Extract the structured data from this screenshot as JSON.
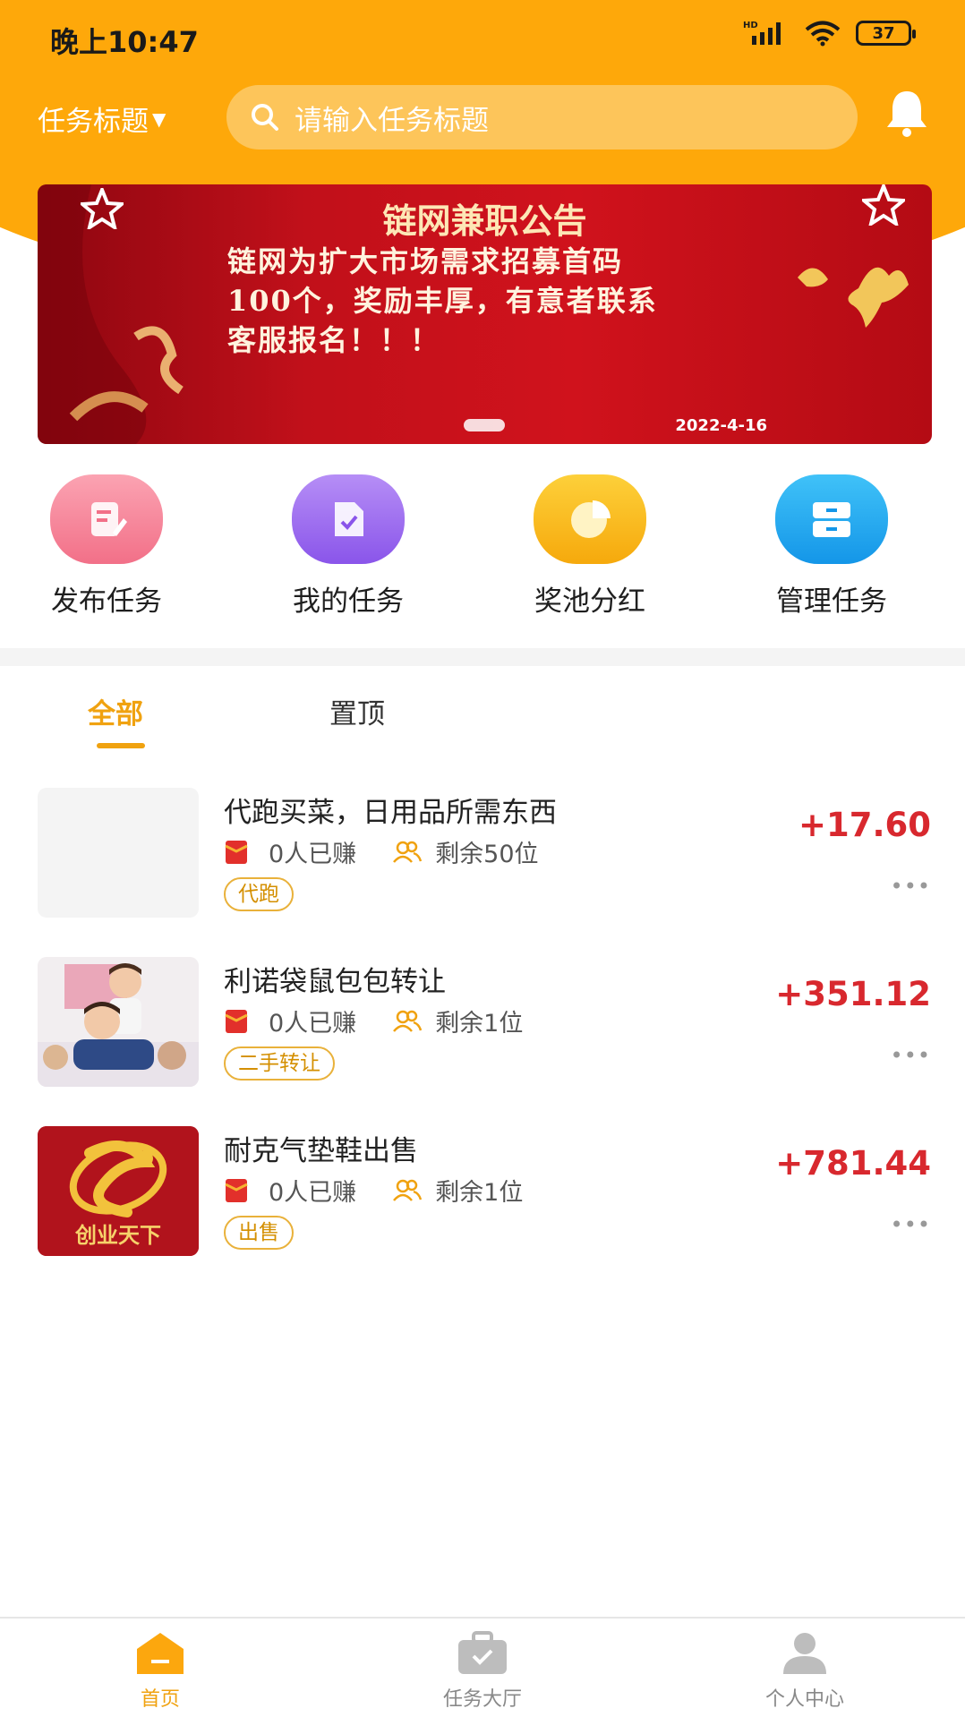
{
  "status_bar": {
    "time": "晚上10:47",
    "battery": "37",
    "network": "HD"
  },
  "header": {
    "title_select": "任务标题",
    "search_placeholder": "请输入任务标题"
  },
  "banner": {
    "title": "链网兼职公告",
    "lines": [
      "链网为扩大市场需求招募首码",
      "100个，奖励丰厚，有意者联系",
      "客服报名！！！"
    ],
    "date": "2022-4-16"
  },
  "actions": [
    {
      "label": "发布任务",
      "color": "#F77E92"
    },
    {
      "label": "我的任务",
      "color": "#9E6BF0"
    },
    {
      "label": "奖池分红",
      "color": "#FBBE1E"
    },
    {
      "label": "管理任务",
      "color": "#21A8F1"
    }
  ],
  "tabs": [
    {
      "label": "全部",
      "active": true
    },
    {
      "label": "置顶",
      "active": false
    }
  ],
  "tasks": [
    {
      "title": "代跑买菜，日用品所需东西",
      "earned": "0人已赚",
      "remaining": "剩余50位",
      "tag": "代跑",
      "price": "+17.60",
      "more": "•••"
    },
    {
      "title": "利诺袋鼠包包转让",
      "earned": "0人已赚",
      "remaining": "剩余1位",
      "tag": "二手转让",
      "price": "+351.12",
      "more": "•••"
    },
    {
      "title": "耐克气垫鞋出售",
      "earned": "0人已赚",
      "remaining": "剩余1位",
      "tag": "出售",
      "price": "+781.44",
      "more": "•••",
      "thumb_text": "创业天下"
    }
  ],
  "bottom_nav": [
    {
      "label": "首页",
      "active": true
    },
    {
      "label": "任务大厅",
      "active": false
    },
    {
      "label": "个人中心",
      "active": false
    }
  ],
  "colors": {
    "brand": "#FEA80A",
    "price": "#D8282E",
    "tag": "#D48F00"
  }
}
